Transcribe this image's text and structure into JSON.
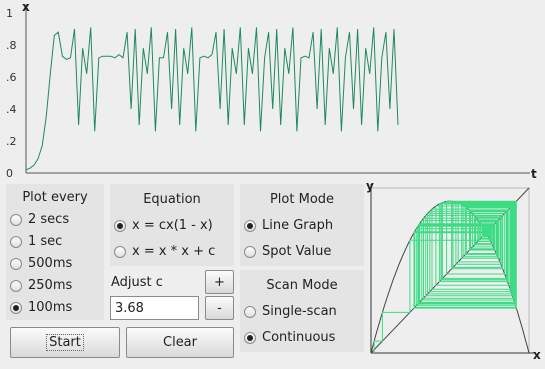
{
  "time_plot": {
    "y_axis_label": "x",
    "x_axis_label": "t",
    "y_tick_labels": [
      "1",
      ".8",
      ".6",
      ".4",
      ".2",
      "0"
    ],
    "line_color": "#1e8a5c",
    "series_x_values": [
      0.02,
      0.03,
      0.05,
      0.09,
      0.17,
      0.35,
      0.62,
      0.86,
      0.88,
      0.73,
      0.71,
      0.72,
      0.9,
      0.3,
      0.78,
      0.62,
      0.91,
      0.26,
      0.72,
      0.73,
      0.73,
      0.73,
      0.72,
      0.74,
      0.72,
      0.88,
      0.4,
      0.9,
      0.3,
      0.78,
      0.62,
      0.91,
      0.26,
      0.72,
      0.72,
      0.88,
      0.4,
      0.9,
      0.3,
      0.78,
      0.62,
      0.91,
      0.26,
      0.72,
      0.73,
      0.72,
      0.74,
      0.88,
      0.4,
      0.9,
      0.3,
      0.78,
      0.62,
      0.91,
      0.3,
      0.78,
      0.62,
      0.91,
      0.26,
      0.72,
      0.88,
      0.4,
      0.9,
      0.3,
      0.78,
      0.62,
      0.91,
      0.26,
      0.72,
      0.73,
      0.72,
      0.88,
      0.4,
      0.9,
      0.3,
      0.78,
      0.62,
      0.91,
      0.26,
      0.72,
      0.88,
      0.4,
      0.9,
      0.3,
      0.78,
      0.62,
      0.91,
      0.26,
      0.72,
      0.88,
      0.4,
      0.9,
      0.3
    ]
  },
  "plot_every": {
    "title": "Plot every",
    "options": [
      "2 secs",
      "1 sec",
      "500ms",
      "250ms",
      "100ms"
    ],
    "selected_index": 4
  },
  "equation": {
    "title": "Equation",
    "options": [
      "x = cx(1 - x)",
      "x = x * x + c"
    ],
    "selected_index": 0
  },
  "plot_mode": {
    "title": "Plot Mode",
    "options": [
      "Line Graph",
      "Spot Value"
    ],
    "selected_index": 0
  },
  "adjust_c": {
    "label": "Adjust c",
    "value": "3.68",
    "plus_label": "+",
    "minus_label": "-"
  },
  "scan_mode": {
    "title": "Scan Mode",
    "options": [
      "Single-scan",
      "Continuous"
    ],
    "selected_index": 1
  },
  "buttons": {
    "start": "Start",
    "clear": "Clear"
  },
  "cobweb": {
    "y_axis_label": "y",
    "x_axis_label": "x",
    "c_value": 3.68,
    "web_color": "#3ddc84",
    "parabola_color": "#444444"
  }
}
